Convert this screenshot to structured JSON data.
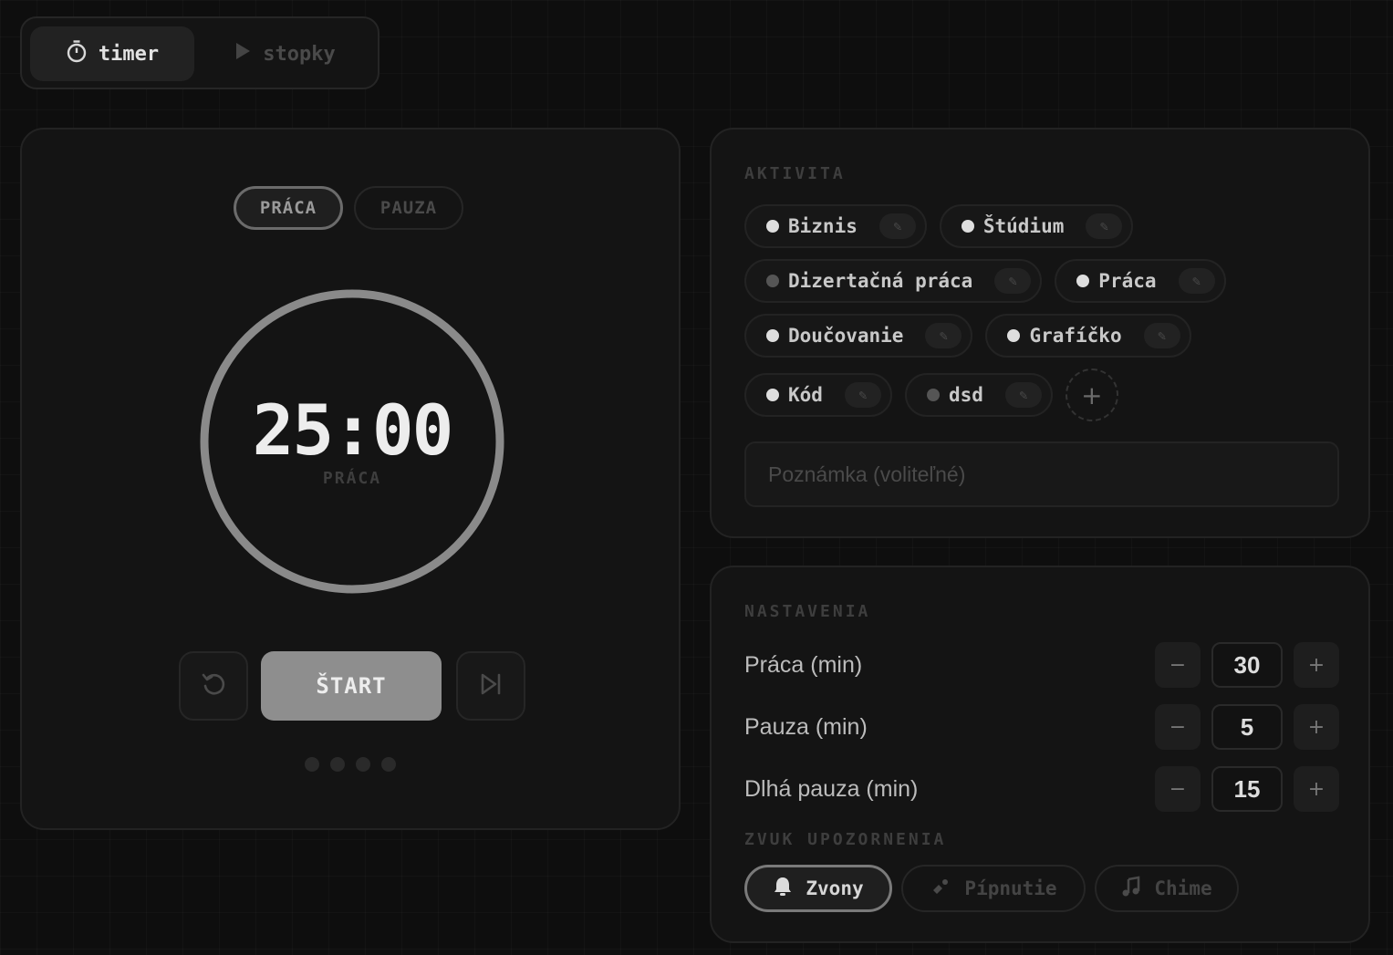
{
  "mode_switch": {
    "timer_label": "timer",
    "stopwatch_label": "stopky",
    "timer_icon": "stopwatch-icon",
    "stopwatch_icon": "play-icon"
  },
  "timer": {
    "tabs": [
      "PRÁCA",
      "PAUZA"
    ],
    "active_tab": "PRÁCA",
    "time": "25:00",
    "phase_label": "PRÁCA",
    "progress": 1.0,
    "start_label": "ŠTART",
    "reset_icon": "reset-icon",
    "skip_icon": "skip-icon",
    "session_dots": 4
  },
  "activity": {
    "title": "AKTIVITA",
    "chips": [
      {
        "label": "Biznis"
      },
      {
        "label": "Štúdium"
      },
      {
        "label": "Dizertačná práca"
      },
      {
        "label": "Práca"
      },
      {
        "label": "Doučovanie"
      },
      {
        "label": "Grafíčko"
      },
      {
        "label": "Kód"
      },
      {
        "label": "dsd"
      }
    ],
    "add_icon": "plus-icon",
    "note_placeholder": "Poznámka (voliteľné)",
    "note_value": ""
  },
  "settings": {
    "title": "NASTAVENIA",
    "rows": [
      {
        "label": "Práca (min)",
        "value": "30"
      },
      {
        "label": "Pauza (min)",
        "value": "5"
      },
      {
        "label": "Dlhá pauza (min)",
        "value": "15"
      }
    ],
    "minus": "−",
    "plus": "+",
    "sound_title": "ZVUK UPOZORNENIA",
    "sounds": [
      {
        "label": "Zvony",
        "icon": "bell-icon"
      },
      {
        "label": "Pípnutie",
        "icon": "beep-icon"
      },
      {
        "label": "Chime",
        "icon": "music-note-icon"
      }
    ],
    "active_sound": "Zvony"
  },
  "colors": {
    "background": "#0e0e0e",
    "panel": "#141414",
    "ring": "#8a8a8a",
    "start_button": "#8e8e8e"
  }
}
